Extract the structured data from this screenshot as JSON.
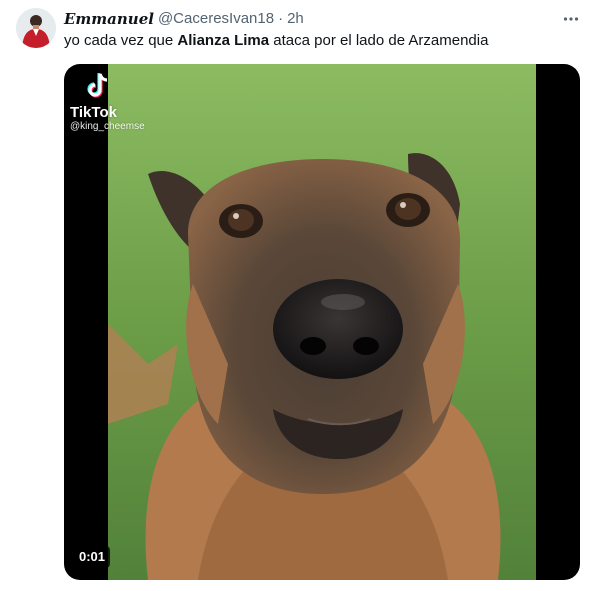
{
  "tweet": {
    "display_name": "Emmanuel",
    "handle": "@CaceresIvan18",
    "separator": "·",
    "time": "2h",
    "text_before": "yo cada vez que ",
    "text_bold": "Alianza Lima",
    "text_after": " ataca por el lado de Arzamendia"
  },
  "media": {
    "watermark_name": "TikTok",
    "watermark_user": "@king_cheemse",
    "duration": "0:01"
  },
  "icons": {
    "more": "more-dots-icon",
    "watermark": "tiktok-logo-icon"
  },
  "colors": {
    "text_primary": "#0f1419",
    "text_secondary": "#536471",
    "media_background": "#000000"
  }
}
